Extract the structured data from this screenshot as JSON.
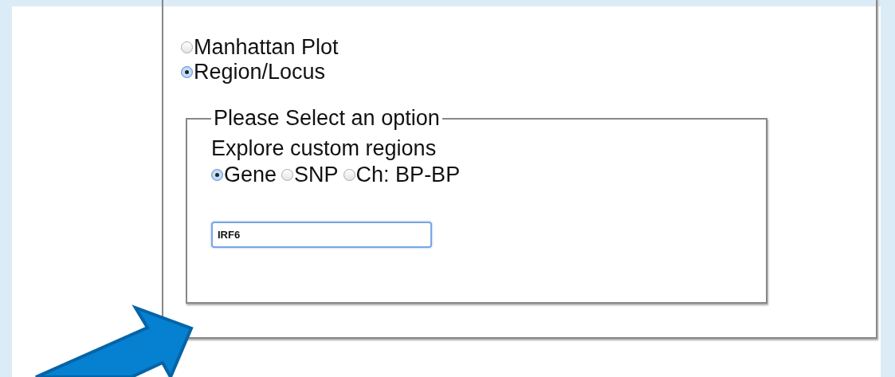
{
  "view_options": [
    {
      "label": "Manhattan Plot",
      "selected": false
    },
    {
      "label": "Region/Locus",
      "selected": true
    }
  ],
  "region_panel": {
    "legend": "Please Select an option",
    "heading": "Explore custom regions",
    "search_types": [
      {
        "label": "Gene",
        "selected": true
      },
      {
        "label": "SNP",
        "selected": false
      },
      {
        "label": "Ch: BP-BP",
        "selected": false
      }
    ],
    "input": {
      "value": "IRF6"
    }
  }
}
